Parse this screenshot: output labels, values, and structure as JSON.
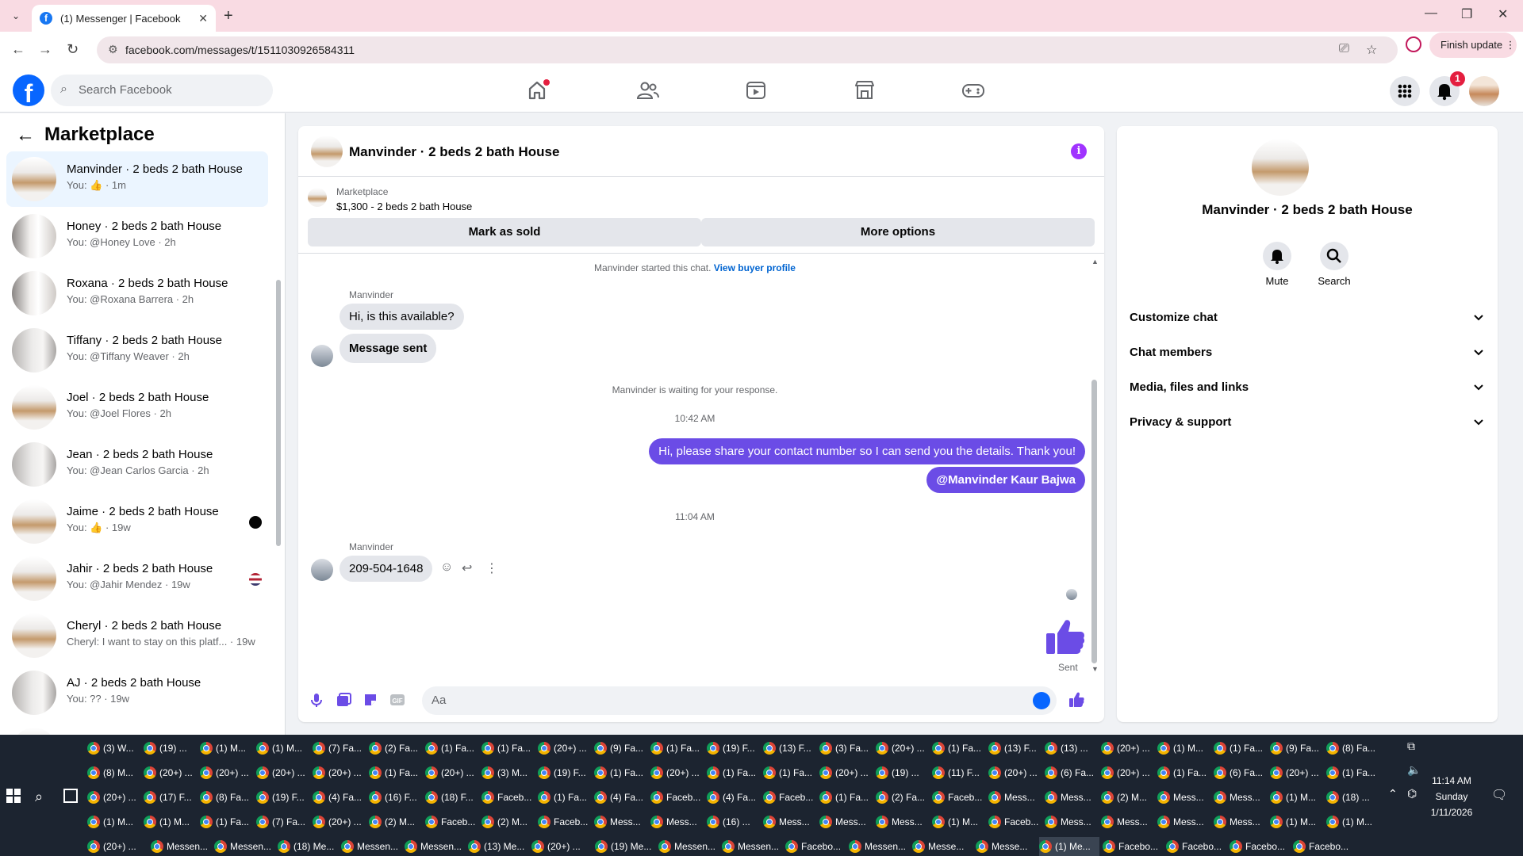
{
  "browser": {
    "tab_title": "(1) Messenger | Facebook",
    "tab_close": "✕",
    "new_tab": "+",
    "url": "facebook.com/messages/t/1511030926584311",
    "finish_update": "Finish update",
    "min": "—",
    "restore": "❐",
    "close": "✕"
  },
  "fb": {
    "logo": "f",
    "search_placeholder": "Search Facebook",
    "notification_count": "1"
  },
  "left": {
    "title": "Marketplace",
    "conversations": [
      {
        "name": "Manvinder · 2 beds 2 bath House",
        "sub": "You: 👍 · 1m"
      },
      {
        "name": "Honey · 2 beds 2 bath House",
        "sub": "You: @Honey Love · 2h"
      },
      {
        "name": "Roxana · 2 beds 2 bath House",
        "sub": "You: @Roxana Barrera · 2h"
      },
      {
        "name": "Tiffany · 2 beds 2 bath House",
        "sub": "You: @Tiffany Weaver · 2h"
      },
      {
        "name": "Joel · 2 beds 2 bath House",
        "sub": "You: @Joel Flores · 2h"
      },
      {
        "name": "Jean · 2 beds 2 bath House",
        "sub": "You: @Jean Carlos Garcia · 2h"
      },
      {
        "name": "Jaime · 2 beds 2 bath House",
        "sub": "You: 👍 · 19w"
      },
      {
        "name": "Jahir · 2 beds 2 bath House",
        "sub": "You: @Jahir Mendez · 19w"
      },
      {
        "name": "Cheryl · 2 beds 2 bath House",
        "sub": "Cheryl: I want to stay on this platf... · 19w"
      },
      {
        "name": "AJ · 2 beds 2 bath House",
        "sub": "You: ?? · 19w"
      }
    ]
  },
  "chat": {
    "title": "Manvinder · 2 beds 2 bath House",
    "listing_source": "Marketplace",
    "listing_desc": "$1,300 - 2 beds 2 bath House",
    "mark_sold": "Mark as sold",
    "more_options": "More options",
    "started_text": "Manvinder started this chat.",
    "view_profile": "View buyer profile",
    "sender1": "Manvinder",
    "msg1": "Hi, is this available?",
    "msg2": "Message sent",
    "waiting": "Manvinder is waiting for your response.",
    "time1": "10:42 AM",
    "out1": "Hi, please share your contact number so I can send you the details. Thank you!",
    "out2": "@Manvinder Kaur Bajwa",
    "time2": "11:04 AM",
    "sender2": "Manvinder",
    "msg3": "209-504-1648",
    "sent": "Sent",
    "composer_placeholder": "Aa"
  },
  "right": {
    "name": "Manvinder · 2 beds 2 bath House",
    "mute": "Mute",
    "search": "Search",
    "sections": [
      "Customize chat",
      "Chat members",
      "Media, files and links",
      "Privacy & support"
    ]
  },
  "taskbar": {
    "rows": [
      [
        "(3) W...",
        "(19) ...",
        "(1) M...",
        "(1) M...",
        "(7) Fa...",
        "(2) Fa...",
        "(1) Fa...",
        "(1) Fa...",
        "(20+) ...",
        "(9) Fa...",
        "(1) Fa...",
        "(19) F...",
        "(13) F...",
        "(3) Fa...",
        "(20+) ...",
        "(1) Fa...",
        "(13) F...",
        "(13) ...",
        "(20+) ...",
        "(1) M...",
        "(1) Fa...",
        "(9) Fa...",
        "(8) Fa..."
      ],
      [
        "(8) M...",
        "(20+) ...",
        "(20+) ...",
        "(20+) ...",
        "(20+) ...",
        "(1) Fa...",
        "(20+) ...",
        "(3) M...",
        "(19) F...",
        "(1) Fa...",
        "(20+) ...",
        "(1) Fa...",
        "(1) Fa...",
        "(20+) ...",
        "(19) ...",
        "(11) F...",
        "(20+) ...",
        "(6) Fa...",
        "(20+) ...",
        "(1) Fa...",
        "(6) Fa...",
        "(20+) ...",
        "(1) Fa..."
      ],
      [
        "(20+) ...",
        "(17) F...",
        "(8) Fa...",
        "(19) F...",
        "(4) Fa...",
        "(16) F...",
        "(18) F...",
        "Faceb...",
        "(1) Fa...",
        "(4) Fa...",
        "Faceb...",
        "(4) Fa...",
        "Faceb...",
        "(1) Fa...",
        "(2) Fa...",
        "Faceb...",
        "Mess...",
        "Mess...",
        "(2) M...",
        "Mess...",
        "Mess...",
        "(1) M...",
        "(18) ..."
      ],
      [
        "(1) M...",
        "(1) M...",
        "(1) Fa...",
        "(7) Fa...",
        "(20+) ...",
        "(2) M...",
        "Faceb...",
        "(2) M...",
        "Faceb...",
        "Mess...",
        "Mess...",
        "(16) ...",
        "Mess...",
        "Mess...",
        "Mess...",
        "(1) M...",
        "Faceb...",
        "Mess...",
        "Mess...",
        "Mess...",
        "Mess...",
        "(1) M...",
        "(1) M..."
      ],
      [
        "(20+) ...",
        "Messen...",
        "Messen...",
        "(18) Me...",
        "Messen...",
        "Messen...",
        "(13) Me...",
        "(20+) ...",
        "(19) Me...",
        "Messen...",
        "Messen...",
        "Facebo...",
        "Messen...",
        "Messe...",
        "Messe...",
        "(1) Me...",
        "Facebo...",
        "Facebo...",
        "Facebo...",
        "Facebo..."
      ]
    ],
    "time": "11:14 AM",
    "day": "Sunday",
    "date": "1/11/2026"
  }
}
